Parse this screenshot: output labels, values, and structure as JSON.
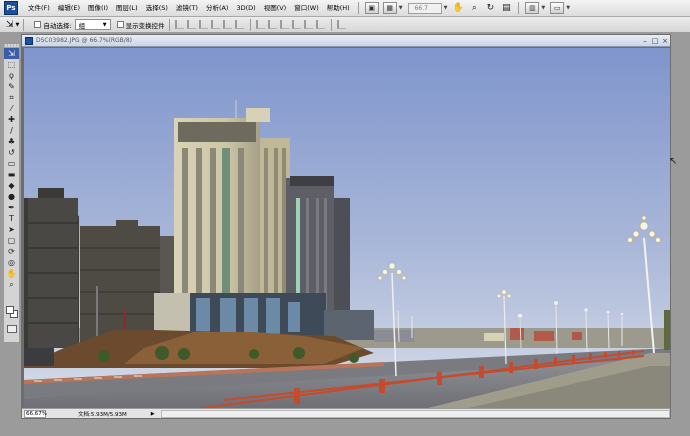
{
  "app": {
    "logo": "Ps"
  },
  "menubar": {
    "items": [
      "文件(F)",
      "编辑(E)",
      "图像(I)",
      "图层(L)",
      "选择(S)",
      "滤镜(T)",
      "分析(A)",
      "3D(D)",
      "视图(V)",
      "窗口(W)",
      "帮助(H)"
    ],
    "zoom_value": "66.7"
  },
  "options": {
    "auto_select_label": "自动选择:",
    "auto_select_value": "组",
    "show_transform_label": "显示变换控件"
  },
  "document": {
    "title": "DSC03982.JPG @ 66.7%(RGB/8)",
    "zoom": "66.67%",
    "info": "文档:5.93M/5.93M"
  },
  "colors": {
    "sky_top": "#7f95cc",
    "sky_bottom": "#d8dde8",
    "railing": "#c44b2e",
    "accent": "#3a5fa8"
  }
}
